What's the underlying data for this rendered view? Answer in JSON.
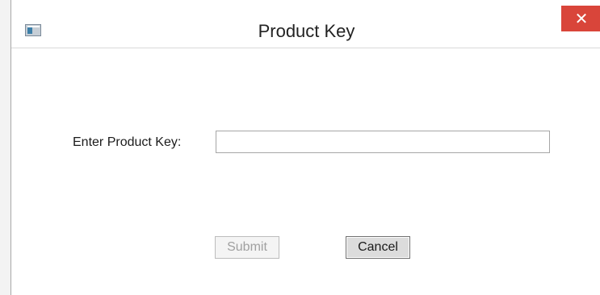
{
  "window": {
    "title": "Product Key",
    "close_glyph": "✕",
    "icon": "app-window-icon"
  },
  "form": {
    "label": "Enter Product Key:",
    "input_value": "",
    "input_placeholder": ""
  },
  "buttons": {
    "submit_label": "Submit",
    "submit_enabled": false,
    "cancel_label": "Cancel"
  },
  "colors": {
    "close_button": "#d9453a",
    "disabled_text": "#a0a0a0"
  }
}
